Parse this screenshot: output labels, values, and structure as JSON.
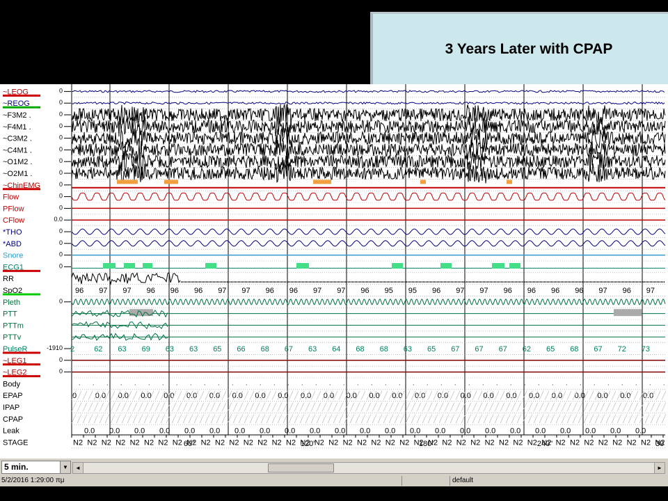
{
  "slide": {
    "title": "3 Years Later with CPAP"
  },
  "channels": [
    {
      "label": "~LEOG",
      "scale": "0",
      "color": "#b00000",
      "underline": "#cc0000",
      "type": "eog"
    },
    {
      "label": "~REOG",
      "scale": "0",
      "color": "#000080",
      "underline": "#00aa00",
      "type": "eog"
    },
    {
      "label": "~F3M2 .",
      "scale": "0",
      "color": "#000000",
      "type": "eeg"
    },
    {
      "label": "~F4M1 .",
      "scale": "0",
      "color": "#000000",
      "type": "eeg"
    },
    {
      "label": "~C3M2 .",
      "scale": "0",
      "color": "#000000",
      "type": "eeg"
    },
    {
      "label": "~C4M1 .",
      "scale": "0",
      "color": "#000000",
      "type": "eeg"
    },
    {
      "label": "~O1M2 .",
      "scale": "0",
      "color": "#000000",
      "type": "eeg"
    },
    {
      "label": "~O2M1 .",
      "scale": "0",
      "color": "#000000",
      "type": "eeg"
    },
    {
      "label": "~ChinEMG",
      "scale": "0",
      "color": "#b00000",
      "underline": "#cc0000",
      "type": "emg"
    },
    {
      "label": "Flow",
      "scale": "0",
      "color": "#c00000",
      "type": "flow"
    },
    {
      "label": "PFlow",
      "scale": "0",
      "color": "#c00000",
      "type": "flat"
    },
    {
      "label": "CFlow",
      "scale": "0.0",
      "color": "#c00000",
      "type": "flat"
    },
    {
      "label": "*THO",
      "scale": "0",
      "color": "#000080",
      "type": "effort"
    },
    {
      "label": "*ABD",
      "scale": "0",
      "color": "#000080",
      "type": "effort"
    },
    {
      "label": "Snore",
      "scale": "0",
      "color": "#3399cc",
      "type": "flat"
    },
    {
      "label": "ECG1",
      "scale": "0",
      "color": "#008060",
      "underline": "#cc0000",
      "type": "ecg"
    },
    {
      "label": "RR",
      "scale": "",
      "color": "#000000",
      "type": "rr"
    },
    {
      "label": "SpO2",
      "scale": "",
      "color": "#000000",
      "underline": "#00cc00",
      "type": "spo2"
    },
    {
      "label": "Pleth",
      "scale": "0",
      "color": "#007040",
      "type": "pleth"
    },
    {
      "label": "PTT",
      "scale": "",
      "color": "#007040",
      "type": "ptt"
    },
    {
      "label": "PTTm",
      "scale": "",
      "color": "#007040",
      "type": "ptt"
    },
    {
      "label": "PTTv",
      "scale": "",
      "color": "#007040",
      "type": "ptt"
    },
    {
      "label": "PulseR",
      "scale": "-1910",
      "color": "#008060",
      "underline": "#cc0000",
      "type": "pulse"
    },
    {
      "label": "~LEG1",
      "scale": "0",
      "color": "#b00000",
      "underline": "#cc0000",
      "type": "leg"
    },
    {
      "label": "~LEG2",
      "scale": "0",
      "color": "#b00000",
      "underline": "#cc0000",
      "type": "leg"
    },
    {
      "label": "Body",
      "scale": "",
      "color": "#000000",
      "type": "body"
    },
    {
      "label": "EPAP",
      "scale": "",
      "color": "#000000",
      "type": "pap"
    },
    {
      "label": "IPAP",
      "scale": "",
      "color": "#000000",
      "type": "blank"
    },
    {
      "label": "CPAP",
      "scale": "",
      "color": "#000000",
      "type": "blank"
    },
    {
      "label": "Leak",
      "scale": "",
      "color": "#000000",
      "type": "leak"
    },
    {
      "label": "STAGE",
      "scale": "",
      "color": "#000000",
      "type": "stage"
    }
  ],
  "spo2_values": [
    "96",
    "97",
    "97",
    "96",
    "96",
    "96",
    "97",
    "97",
    "96",
    "96",
    "97",
    "97",
    "96",
    "95",
    "95",
    "96",
    "97",
    "97",
    "96",
    "96",
    "96",
    "96",
    "97",
    "96",
    "97"
  ],
  "pulse_values": [
    "2",
    "62",
    "63",
    "69",
    "63",
    "63",
    "65",
    "66",
    "68",
    "67",
    "63",
    "64",
    "68",
    "68",
    "63",
    "65",
    "67",
    "67",
    "67",
    "62",
    "65",
    "68",
    "67",
    "72",
    "73"
  ],
  "epap_values": [
    "0",
    "0.0",
    "0.0",
    "0.0",
    "0.0",
    "0.0",
    "0.0",
    "0.0",
    "0.0",
    "0.0",
    "0.0",
    "0.0",
    "0.0",
    "0.0",
    "0.0",
    "0.0",
    "0.0",
    "0.0",
    "0.0",
    "0.0",
    "0.0",
    "0.0",
    "0.0",
    "0.0",
    "0.0",
    "0.0"
  ],
  "leak_values": [
    "0.0",
    "0.0",
    "0.0",
    "0.0",
    "0.0",
    "0.0",
    "0.0",
    "0.0",
    "0.0",
    "0.0",
    "0.0",
    "0.0",
    "0.0",
    "0.0",
    "0.0",
    "0.0",
    "0.0",
    "0.0",
    "0.0",
    "0.0",
    "0.0",
    "0.0",
    "0.0"
  ],
  "stage_label": "N2",
  "time_axis": [
    "60\"",
    "120\"",
    "180\"",
    "240\"",
    "30"
  ],
  "controls": {
    "epoch_selector": "5 min.",
    "datetime": "5/2/2016 1:29:00 πμ",
    "profile": "default"
  },
  "colors": {
    "chart_bg": "#ffffff",
    "title_bg": "#cce8ec",
    "event_orange": "#f0a040",
    "event_green": "#44dd88"
  }
}
